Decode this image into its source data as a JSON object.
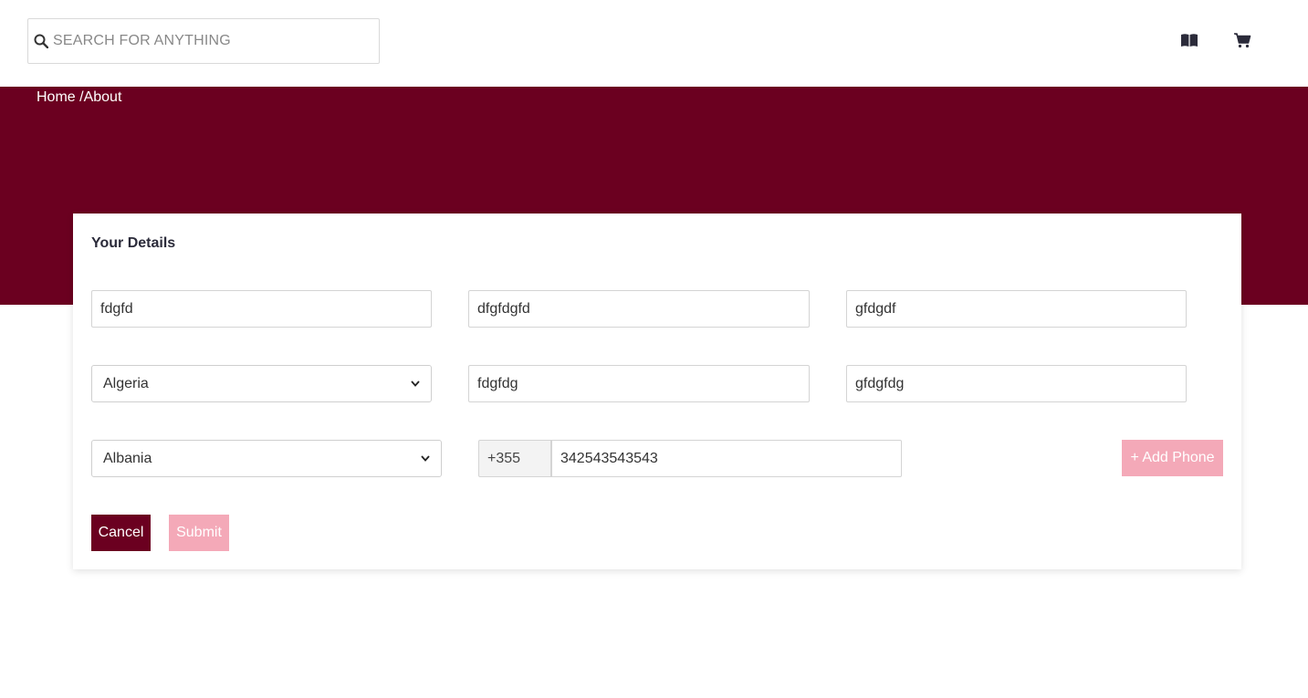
{
  "search": {
    "placeholder": "SEARCH FOR ANYTHING"
  },
  "header_icons": [
    "book-icon",
    "cart-icon"
  ],
  "breadcrumb": {
    "home": "Home",
    "separator": " /",
    "current": "About"
  },
  "colors": {
    "brand": "#6b0020",
    "accent_light": "#f4a9b8"
  },
  "form": {
    "title": "Your Details",
    "row1": [
      "fdgfd",
      "dfgfdgfd",
      "gfdgdf"
    ],
    "row2": {
      "country": "Algeria",
      "field2": "fdgfdg",
      "field3": "gfdgfdg"
    },
    "phone": {
      "country": "Albania",
      "prefix": "+355",
      "number": "342543543543"
    },
    "add_phone_label": "+ Add Phone",
    "cancel_label": "Cancel",
    "submit_label": "Submit"
  }
}
